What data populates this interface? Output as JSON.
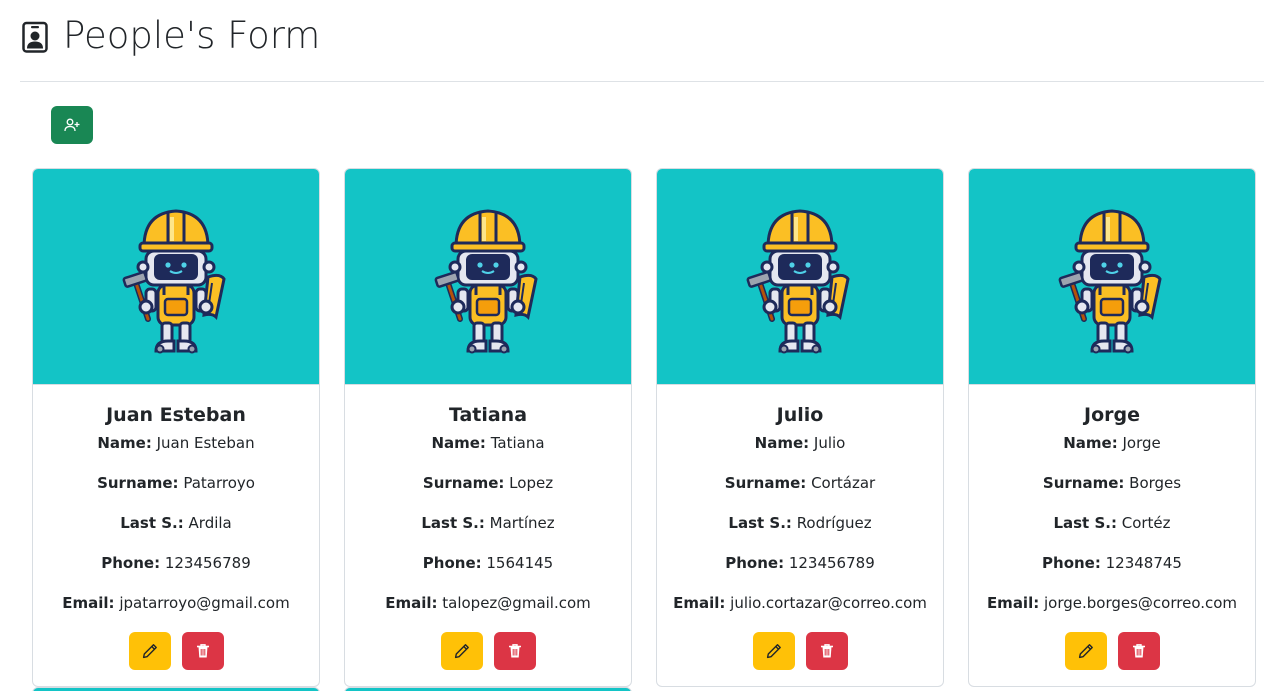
{
  "header": {
    "title": "People's Form",
    "icon": "person-badge-icon"
  },
  "toolbar": {
    "add_icon": "person-plus-icon",
    "add_color": "#198754"
  },
  "colors": {
    "card_image_bg": "#13c4c6",
    "edit": "#ffc107",
    "delete": "#dc3545"
  },
  "labels": {
    "name": "Name:",
    "surname": "Surname:",
    "last": "Last S.:",
    "phone": "Phone:",
    "email": "Email:"
  },
  "people": [
    {
      "title": "Juan Esteban",
      "name": "Juan Esteban",
      "surname": "Patarroyo",
      "last": "Ardila",
      "phone": "123456789",
      "email": "jpatarroyo@gmail.com"
    },
    {
      "title": "Tatiana",
      "name": "Tatiana",
      "surname": "Lopez",
      "last": "Martínez",
      "phone": "1564145",
      "email": "talopez@gmail.com"
    },
    {
      "title": "Julio",
      "name": "Julio",
      "surname": "Cortázar",
      "last": "Rodríguez",
      "phone": "123456789",
      "email": "julio.cortazar@correo.com"
    },
    {
      "title": "Jorge",
      "name": "Jorge",
      "surname": "Borges",
      "last": "Cortéz",
      "phone": "12348745",
      "email": "jorge.borges@correo.com"
    }
  ]
}
